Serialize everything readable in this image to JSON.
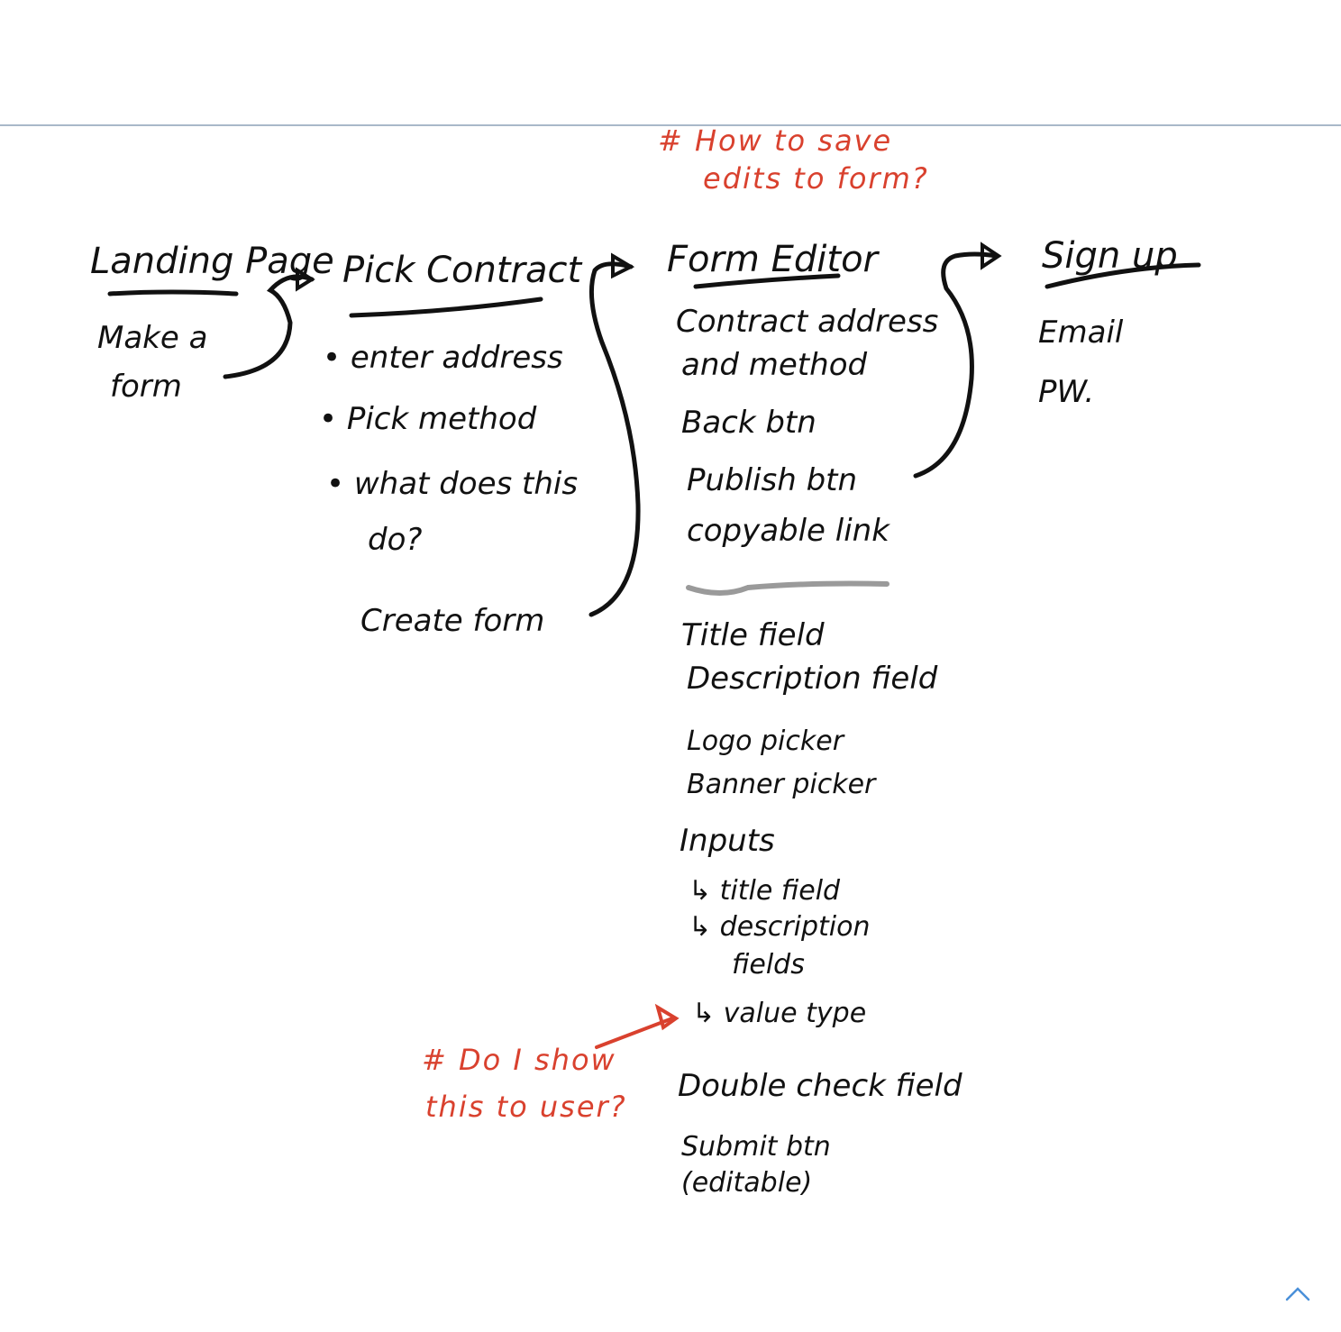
{
  "colors": {
    "ink": "#111111",
    "note": "#d9412e",
    "divider": "#9a9a9a",
    "rule": "#a9b8c9",
    "scroll_icon": "#4a90d9"
  },
  "notes": {
    "save_edits": [
      "# How to save",
      "edits to form?"
    ],
    "show_user": [
      "# Do I show",
      "this to user?"
    ]
  },
  "landing": {
    "title": "Landing Page",
    "items": [
      "Make a",
      "form"
    ]
  },
  "pick_contract": {
    "title": "Pick Contract",
    "items": [
      "• enter address",
      "• Pick method",
      "• what does this",
      "do?"
    ],
    "create": "Create form"
  },
  "form_editor": {
    "title": "Form Editor",
    "group1": [
      "Contract address",
      "and method",
      "Back btn",
      "Publish btn",
      "copyable link"
    ],
    "group2": [
      "Title field",
      "Description field",
      "Logo picker",
      "Banner picker"
    ],
    "inputs_title": "Inputs",
    "inputs_items": [
      "↳ title field",
      "↳ description",
      "fields",
      "↳ value type"
    ],
    "group3": [
      "Double check field",
      "Submit btn",
      "(editable)"
    ]
  },
  "signup": {
    "title": "Sign up",
    "items": [
      "Email",
      "PW."
    ]
  },
  "scroll_icon": "chevron-up-icon"
}
